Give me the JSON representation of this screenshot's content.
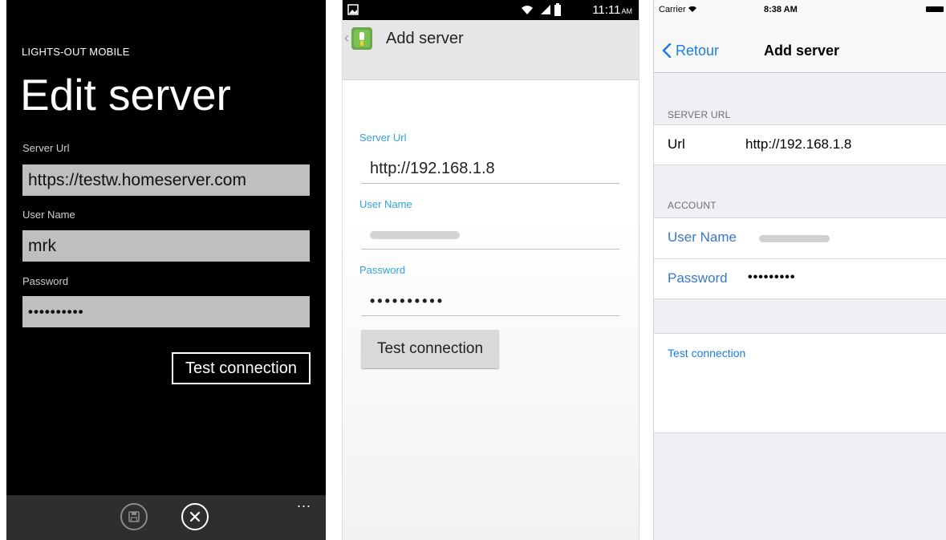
{
  "windows_phone": {
    "app_name": "LIGHTS-OUT MOBILE",
    "page_title": "Edit server",
    "server_url_label": "Server Url",
    "server_url_value": "https://testw.homeserver.com",
    "user_name_label": "User Name",
    "user_name_value": "mrk",
    "password_label": "Password",
    "password_value": "••••••••••",
    "test_button": "Test connection",
    "more": "...",
    "icons": [
      "save-icon",
      "close-icon"
    ]
  },
  "android": {
    "status_time": "11:11",
    "status_ampm": "AM",
    "title": "Add server",
    "server_url_label": "Server Url",
    "server_url_value": "http://192.168.1.8",
    "user_name_label": "User Name",
    "password_label": "Password",
    "password_value": "••••••••••",
    "test_button": "Test connection",
    "accent": "#33a4d8"
  },
  "ios": {
    "carrier": "Carrier",
    "time": "8:38 AM",
    "back_label": "Retour",
    "title": "Add server",
    "section_server": "SERVER URL",
    "url_label": "Url",
    "url_value": "http://192.168.1.8",
    "section_account": "ACCOUNT",
    "user_name_label": "User Name",
    "password_label": "Password",
    "password_value": "•••••••••",
    "test_connection": "Test connection",
    "accent": "#1a7ee5"
  }
}
